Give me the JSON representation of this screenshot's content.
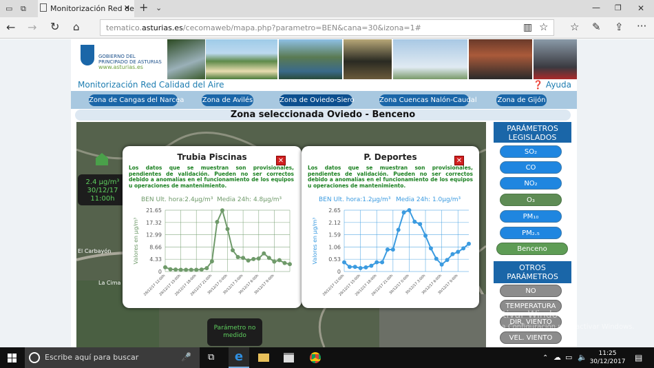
{
  "browser": {
    "tab_title": "Monitorización Red de",
    "url_prefix": "tematico.",
    "url_domain": "asturias.es",
    "url_rest": "/cecomaweb/mapa.php?parametro=BEN&cana=30&izona=1#"
  },
  "site": {
    "logo_line1": "GOBIERNO DEL",
    "logo_line2": "PRINCIPADO DE ASTURIAS",
    "logo_url": "www.asturias.es",
    "title": "Monitorización Red Calidad del Aire",
    "help": "Ayuda",
    "zones": [
      "Zona de Cangas del Narcea",
      "Zona de Avilés",
      "Zona de Oviedo-Siero",
      "Zona Cuencas Nalón-Caudal",
      "Zona de Gijón"
    ],
    "selected_header": "Zona seleccionada Oviedo - Benceno"
  },
  "map": {
    "station_value": "2.4 µg/m³",
    "station_date": "30/12/17",
    "station_time": "11:00h",
    "place_label": "El Carbayón",
    "place_label2": "La Cima",
    "no_measure": "Parámetro no medido"
  },
  "side": {
    "legislated_header": "PARÁMETROS LEGISLADOS",
    "legislated": [
      "SO₂",
      "CO",
      "NO₂",
      "O₃",
      "PM₁₀",
      "PM₂.₅",
      "Benceno"
    ],
    "other_header": "OTROS PARÁMETROS",
    "other": [
      "NO",
      "TEMPERATURA",
      "DIR. VIENTO",
      "VEL. VIENTO"
    ]
  },
  "popups": [
    {
      "title": "Trubia Piscinas",
      "note": "Los datos que se muestran son provisionales, pendientes de validación. Pueden no ser correctos debido a anomalías en el funcionamiento de los equipos u operaciones de mantenimiento.",
      "stat_last": "BEN Ult. hora:2.4µg/m³",
      "stat_avg": "Media 24h: 4.8µg/m³"
    },
    {
      "title": "P. Deportes",
      "note": "Los datos que se muestran son provisionales, pendientes de validación. Pueden no ser correctos debido a anomalías en el funcionamiento de los equipos u operaciones de mantenimiento.",
      "stat_last": "BEN Ult. hora:1.2µg/m³",
      "stat_avg": "Media 24h: 1.0µg/m³"
    }
  ],
  "chart_data": [
    {
      "type": "line",
      "title": "Trubia Piscinas",
      "ylabel": "Valores en µg/m³",
      "ylim": [
        0,
        21.65
      ],
      "yticks": [
        "0",
        "4.33",
        "8.66",
        "12.99",
        "17.32",
        "21.65"
      ],
      "xticks": [
        "29/12/17 12:00h",
        "29/12/17 15:00h",
        "29/12/17 18:00h",
        "29/12/17 21:00h",
        "30/12/17 0:00h",
        "30/12/17 3:00h",
        "30/12/17 6:00h",
        "30/12/17 9:00h"
      ],
      "color": "#6f9a6a",
      "values": [
        1.5,
        0.8,
        0.7,
        0.6,
        0.6,
        0.6,
        0.6,
        0.7,
        1.2,
        3.6,
        17.5,
        21.6,
        15.0,
        7.5,
        5.1,
        4.8,
        3.9,
        4.4,
        4.6,
        6.4,
        4.8,
        3.5,
        4.0,
        3.0,
        2.6
      ]
    },
    {
      "type": "line",
      "title": "P. Deportes",
      "ylabel": "Valores en µg/m³",
      "ylim": [
        0,
        2.65
      ],
      "yticks": [
        "0",
        "0.53",
        "1.06",
        "1.59",
        "2.12",
        "2.65"
      ],
      "xticks": [
        "29/12/17 12:00h",
        "29/12/17 15:00h",
        "29/12/17 18:00h",
        "29/12/17 21:00h",
        "30/12/17 0:00h",
        "30/12/17 3:00h",
        "30/12/17 6:00h",
        "30/12/17 9:00h"
      ],
      "color": "#3b9be0",
      "values": [
        0.4,
        0.2,
        0.2,
        0.15,
        0.18,
        0.25,
        0.4,
        0.4,
        0.95,
        0.95,
        1.8,
        2.55,
        2.65,
        2.15,
        2.05,
        1.55,
        1.0,
        0.55,
        0.3,
        0.5,
        0.75,
        0.85,
        1.0,
        1.2
      ]
    }
  ],
  "watermark": {
    "line1": "Activar Windows",
    "line2": "Ve a Configuración para activar Windows."
  },
  "taskbar": {
    "search_placeholder": "Escribe aquí para buscar",
    "time": "11:25",
    "date": "30/12/2017"
  }
}
